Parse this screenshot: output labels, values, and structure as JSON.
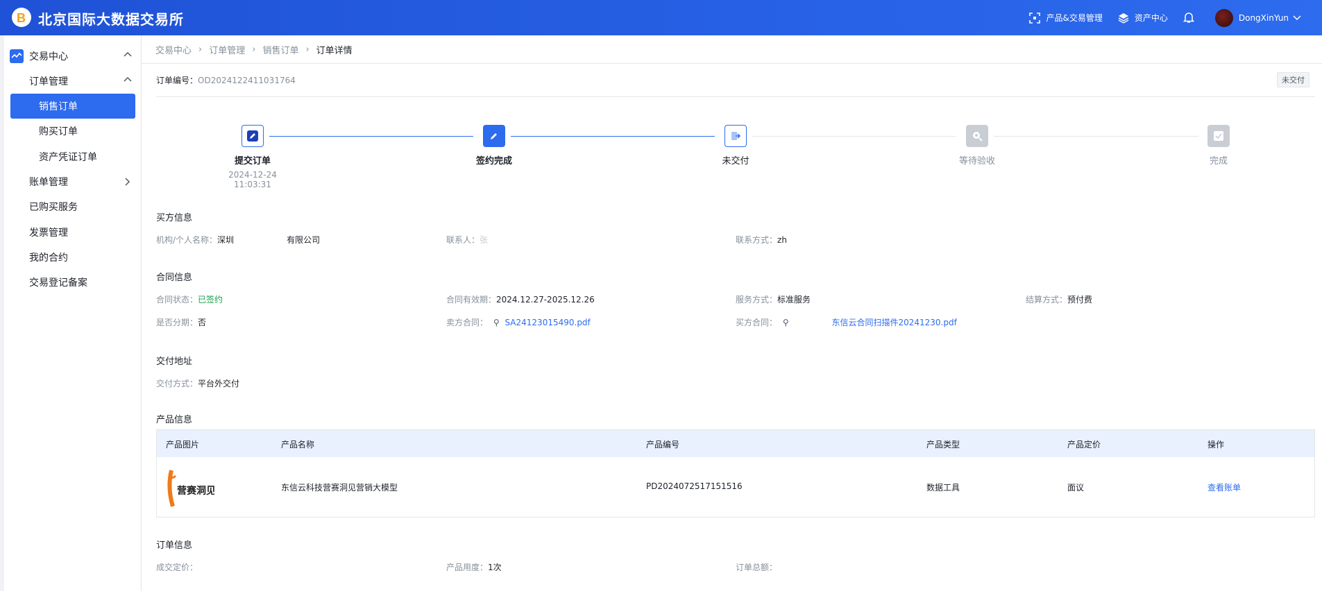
{
  "header": {
    "brand": "北京国际大数据交易所",
    "nav_products": "产品&交易管理",
    "nav_assets": "资产中心",
    "username": "DongXinYun"
  },
  "sidebar": {
    "group_label": "交易中心",
    "order_mgmt": "订单管理",
    "sales_orders": "销售订单",
    "purchase_orders": "购买订单",
    "asset_orders": "资产凭证订单",
    "billing": "账单管理",
    "purchased_services": "已购买服务",
    "invoice": "发票管理",
    "contracts": "我的合约",
    "registration": "交易登记备案"
  },
  "breadcrumb": {
    "c1": "交易中心",
    "c2": "订单管理",
    "c3": "销售订单",
    "c4": "订单详情"
  },
  "order": {
    "no_label": "订单编号：",
    "no_value": "OD2024122411031764",
    "status_badge": "未交付"
  },
  "steps": [
    {
      "title": "提交订单",
      "date": "2024-12-24 11:03:31"
    },
    {
      "title": "签约完成",
      "date": ""
    },
    {
      "title": "未交付",
      "date": ""
    },
    {
      "title": "等待验收",
      "date": ""
    },
    {
      "title": "完成",
      "date": ""
    }
  ],
  "buyer": {
    "section": "买方信息",
    "org_label": "机构/个人名称：",
    "org_value": "深圳",
    "org_value_tail": "有限公司",
    "contact_label": "联系人：",
    "contact_value": "张",
    "phone_label": "联系方式：",
    "phone_value": "zh"
  },
  "contract": {
    "section": "合同信息",
    "status_label": "合同状态：",
    "status_value": "已签约",
    "validity_label": "合同有效期：",
    "validity_value": "2024.12.27-2025.12.26",
    "service_label": "服务方式：",
    "service_value": "标准服务",
    "settle_label": "结算方式：",
    "settle_value": "预付费",
    "install_label": "是否分期：",
    "install_value": "否",
    "seller_label": "卖方合同：",
    "seller_value": "SA24123015490.pdf",
    "buyer_label": "买方合同：",
    "buyer_value": "东信云合同扫描件20241230.pdf"
  },
  "delivery": {
    "section": "交付地址",
    "mode_label": "交付方式：",
    "mode_value": "平台外交付"
  },
  "product": {
    "section": "产品信息",
    "headers": [
      "产品图片",
      "产品名称",
      "产品编号",
      "产品类型",
      "产品定价",
      "操作"
    ],
    "img_text": "营赛洞见",
    "name": "东信云科技营赛洞见营销大模型",
    "code": "PD2024072517151516",
    "type": "数据工具",
    "price": "面议",
    "action": "查看账单"
  },
  "orderinfo": {
    "section": "订单信息",
    "deal_label": "成交定价：",
    "usage_label": "产品用度：",
    "usage_value": "1次",
    "total_label": "订单总额："
  }
}
